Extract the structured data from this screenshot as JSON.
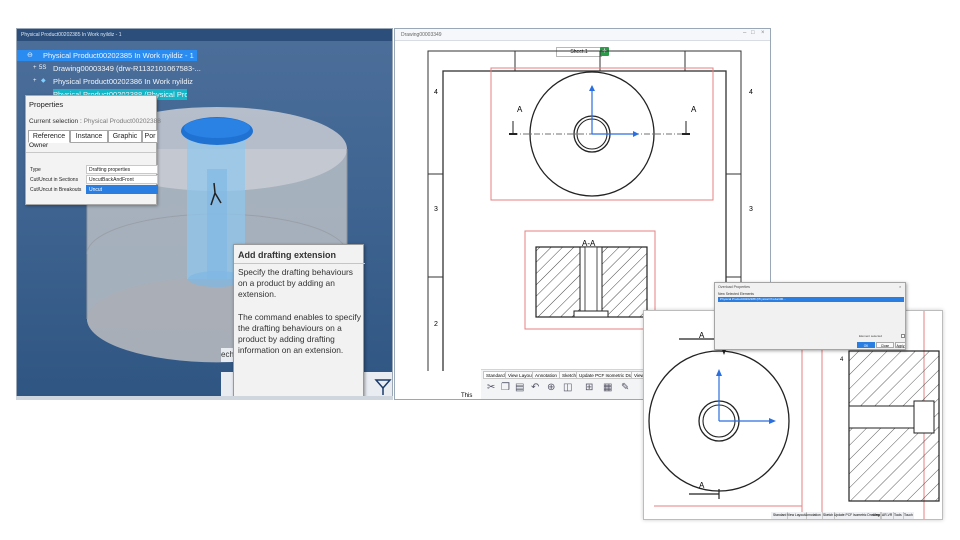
{
  "viewport3d": {
    "window_title": "Physical Product00202385 In Work nyildiz - 1",
    "tree": [
      {
        "label": "Physical Product00202385 In Work nyildiz - 1"
      },
      {
        "label": "Drawing00003349 (drw-R1132101067583-..."
      },
      {
        "label": "Physical Product00202386 In Work nyildiz"
      },
      {
        "label": "Physical Product00202388 (Physical Produ..."
      }
    ],
    "tree_prefix": "5S"
  },
  "properties": {
    "title": "Properties",
    "current_selection_label": "Current selection :",
    "current_selection_value": "Physical Product00202388",
    "tabs": [
      "Reference",
      "Instance",
      "Graphic",
      "Por"
    ],
    "owner_label": "Owner",
    "rows": [
      {
        "key": "Type",
        "value": "Drafting properties"
      },
      {
        "key": "Cut/Uncut in Sections",
        "value": "UncutBackAndFront"
      },
      {
        "key": "Cut/Uncut in Breakouts",
        "value": "Uncut"
      }
    ]
  },
  "tooltip": {
    "title": "Add drafting extension",
    "para1": "Specify the drafting behaviours on a product by adding an extension.",
    "para2": "The command enables to specify the drafting behaviours on a product by adding drafting information on an extension."
  },
  "toolbar3d": {
    "side_label": "ech",
    "buttons": [
      "add-drafting-extension-icon",
      "drafting-filter-icon",
      "books-icon",
      "refresh-icon",
      "more-icon"
    ]
  },
  "drawing": {
    "window_title": "Drawing00003349",
    "sheet_tab": "Sheet.1",
    "add_sheet": "+",
    "row_numbers": [
      "4",
      "3",
      "2"
    ],
    "section_label_left": "A",
    "section_label_right": "A",
    "section_view_label": "A-A",
    "title_fragment": "This",
    "toolbar_tabs": [
      "Standard",
      "View Layout",
      "Annotation",
      "Sketch",
      "Update PCF Isometric Drawing",
      "View"
    ]
  },
  "zoom": {
    "label_a_top": "A",
    "label_a_bottom": "A",
    "row_number": "4",
    "toolbar_tabs": [
      "Standard",
      "View Layout",
      "Annotation",
      "Sketch",
      "Update PCF Isometric Drawing",
      "View",
      "AR-VR",
      "Tools",
      "Touch"
    ]
  },
  "dialog": {
    "title": "Overload Properties",
    "subtitle": "New Selected Elements",
    "selected_row": "Physical Product00202388 (Physical Product00...",
    "checkbox_label": "Element selected",
    "buttons": [
      "OK",
      "Close",
      "Apply"
    ]
  },
  "colors": {
    "selection_blue": "#2a8bf0",
    "selection_cyan": "#14b6c7",
    "highlight_blue": "#2a7de1",
    "frame_red": "#e58080",
    "axis_blue": "#2a6fe0"
  }
}
